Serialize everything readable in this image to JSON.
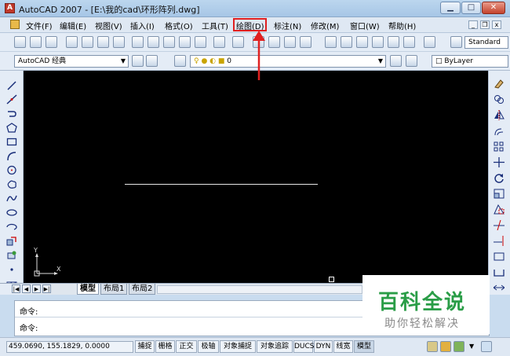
{
  "window": {
    "title": "AutoCAD 2007 - [E:\\我的cad\\环形阵列.dwg]"
  },
  "menu": [
    {
      "label": "文件(F)"
    },
    {
      "label": "编辑(E)"
    },
    {
      "label": "视图(V)"
    },
    {
      "label": "插入(I)"
    },
    {
      "label": "格式(O)"
    },
    {
      "label": "工具(T)"
    },
    {
      "label": "绘图(D)"
    },
    {
      "label": "标注(N)"
    },
    {
      "label": "修改(M)"
    },
    {
      "label": "窗口(W)"
    },
    {
      "label": "帮助(H)"
    }
  ],
  "toolbar": {
    "text_style": "Standard",
    "workspace": "AutoCAD 经典",
    "layer": "0",
    "linetype": "ByLayer"
  },
  "drawing": {
    "ucs_y": "Y",
    "ucs_x": "X"
  },
  "tabs": [
    {
      "label": "模型"
    },
    {
      "label": "布局1"
    },
    {
      "label": "布局2"
    }
  ],
  "command": {
    "line1": "命令:",
    "line2": "命令:"
  },
  "watermark": {
    "title": "百科全说",
    "subtitle": "助你轻松解决"
  },
  "status": {
    "coords": "459.0690, 155.1829, 0.0000",
    "buttons": [
      "捕捉",
      "栅格",
      "正交",
      "极轴",
      "对象捕捉",
      "对象追踪",
      "DUCS",
      "DYN",
      "线宽",
      "模型"
    ]
  },
  "colors": {
    "highlight": "#e02020",
    "canvas": "#000000",
    "watermark_green": "#2a9d47"
  }
}
